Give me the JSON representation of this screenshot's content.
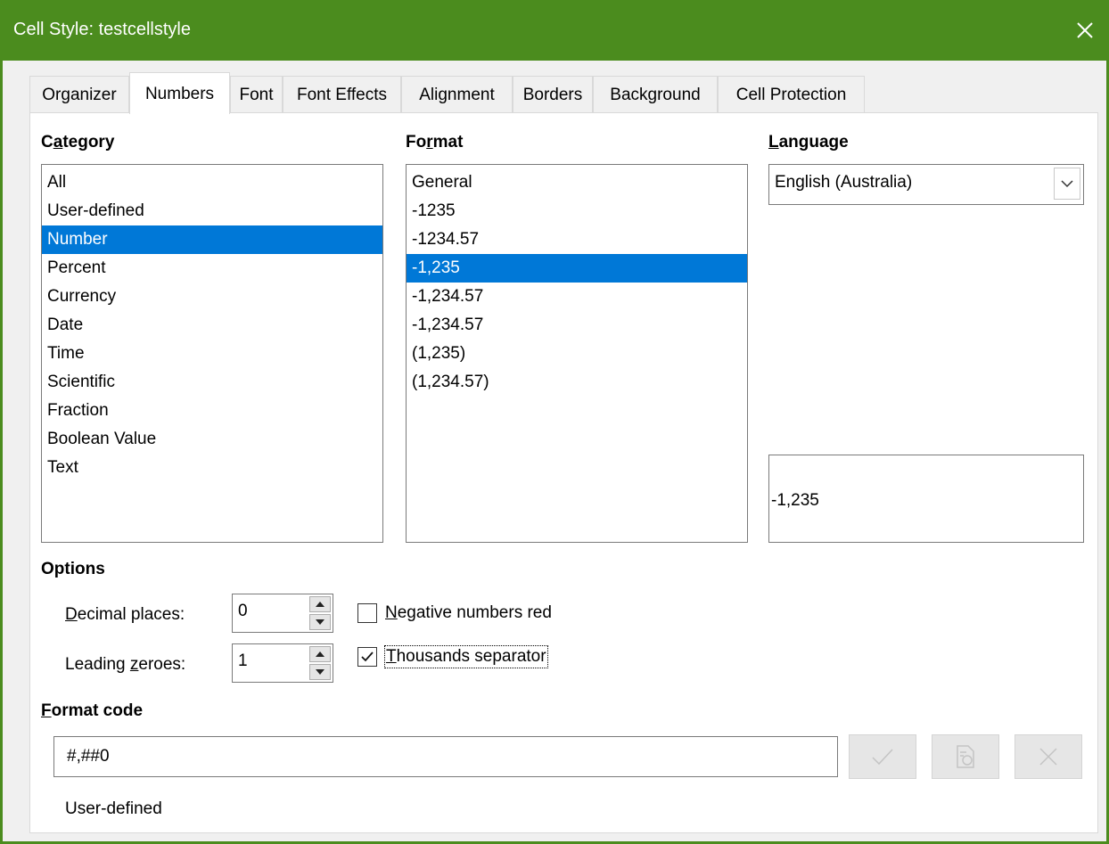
{
  "window": {
    "title": "Cell Style: testcellstyle",
    "close_icon": "close-icon"
  },
  "tabs": [
    {
      "label": "Organizer",
      "active": false
    },
    {
      "label": "Numbers",
      "active": true
    },
    {
      "label": "Font",
      "active": false
    },
    {
      "label": "Font Effects",
      "active": false
    },
    {
      "label": "Alignment",
      "active": false
    },
    {
      "label": "Borders",
      "active": false
    },
    {
      "label": "Background",
      "active": false
    },
    {
      "label": "Cell Protection",
      "active": false
    }
  ],
  "category": {
    "label_pre": "C",
    "label_ul": "a",
    "label_post": "tegory",
    "items": [
      "All",
      "User-defined",
      "Number",
      "Percent",
      "Currency",
      "Date",
      "Time",
      "Scientific",
      "Fraction",
      "Boolean Value",
      "Text"
    ],
    "selected": "Number"
  },
  "format": {
    "label_pre": "Fo",
    "label_ul": "r",
    "label_post": "mat",
    "items": [
      "General",
      "-1235",
      "-1234.57",
      "-1,235",
      "-1,234.57",
      "-1,234.57",
      "(1,235)",
      "(1,234.57)"
    ],
    "selected": "-1,235"
  },
  "language": {
    "label_pre": "",
    "label_ul": "L",
    "label_post": "anguage",
    "value": "English (Australia)"
  },
  "preview": {
    "value": "-1,235"
  },
  "options": {
    "label": "Options",
    "decimal_places": {
      "label_pre": "",
      "label_ul": "D",
      "label_post": "ecimal places:",
      "value": "0"
    },
    "leading_zeroes": {
      "label_pre": "Leading ",
      "label_ul": "z",
      "label_post": "eroes:",
      "value": "1"
    },
    "negative_red": {
      "label_pre": "",
      "label_ul": "N",
      "label_post": "egative numbers red",
      "checked": false
    },
    "thousands_sep": {
      "label_pre": "",
      "label_ul": "T",
      "label_post": "housands separator",
      "checked": true
    }
  },
  "format_code": {
    "label_pre": "",
    "label_ul": "F",
    "label_post": "ormat code",
    "value": "#,##0",
    "description": "User-defined"
  },
  "colors": {
    "titlebar": "#4b8c1e",
    "selection": "#0078d7"
  }
}
